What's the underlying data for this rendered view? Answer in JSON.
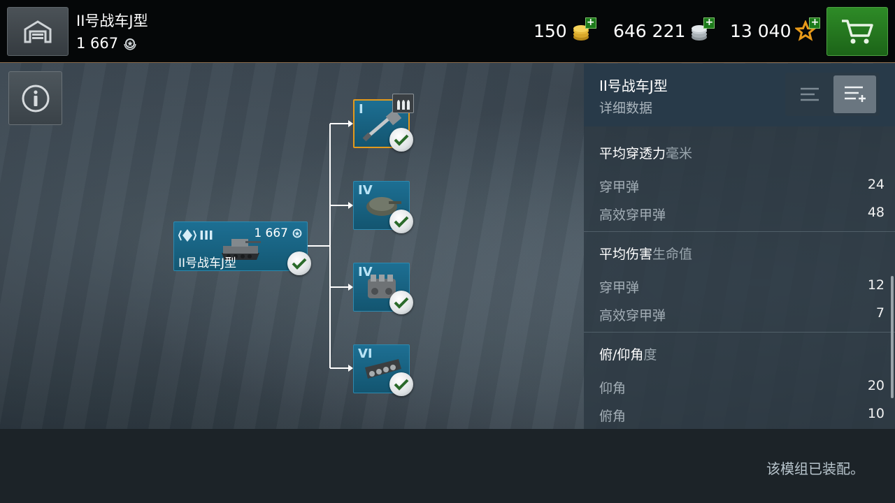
{
  "topbar": {
    "tank_name": "II号战车J型",
    "tank_xp": "1 667",
    "gold": "150",
    "credits": "646 221",
    "free_xp": "13 040",
    "plus_label": "+"
  },
  "tree": {
    "tank": {
      "tier": "III",
      "xp": "1 667",
      "name": "II号战车J型"
    },
    "modules": [
      {
        "tier": "I",
        "type": "gun",
        "selected": true,
        "researched": true
      },
      {
        "tier": "IV",
        "type": "turret",
        "selected": false,
        "researched": true
      },
      {
        "tier": "IV",
        "type": "engine",
        "selected": false,
        "researched": true
      },
      {
        "tier": "VI",
        "type": "suspension",
        "selected": false,
        "researched": true
      }
    ]
  },
  "panel": {
    "title": "II号战车J型",
    "subtitle": "详细数据",
    "sections": [
      {
        "title": "平均穿透力",
        "unit": "毫米",
        "rows": [
          {
            "label": "穿甲弹",
            "value": "24"
          },
          {
            "label": "高效穿甲弹",
            "value": "48"
          }
        ]
      },
      {
        "title": "平均伤害",
        "unit": "生命值",
        "rows": [
          {
            "label": "穿甲弹",
            "value": "12"
          },
          {
            "label": "高效穿甲弹",
            "value": "7"
          }
        ]
      },
      {
        "title": "俯/仰角",
        "unit": "度",
        "rows": [
          {
            "label": "仰角",
            "value": "20"
          },
          {
            "label": "俯角",
            "value": "10"
          }
        ]
      }
    ]
  },
  "status_message": "该模组已装配。",
  "colors": {
    "accent_blue": "#1d6f93",
    "selected_orange": "#e39a1c",
    "shop_green": "#2e8b27"
  }
}
